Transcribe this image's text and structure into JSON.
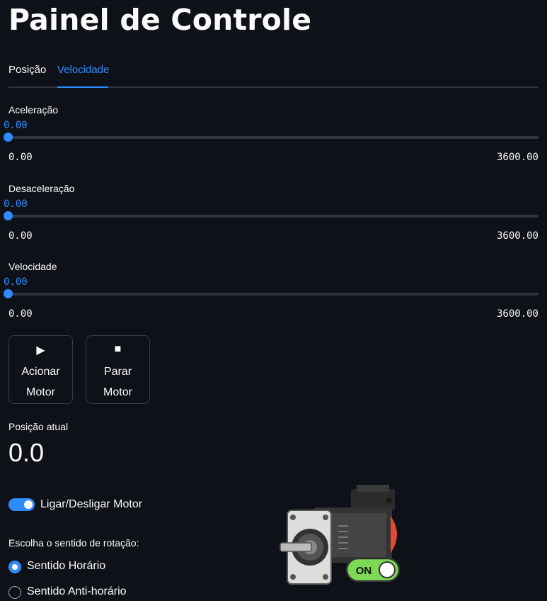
{
  "page": {
    "title": "Painel de Controle"
  },
  "tabs": [
    {
      "label": "Posição",
      "active": false
    },
    {
      "label": "Velocidade",
      "active": true
    }
  ],
  "sliders": [
    {
      "label": "Aceleração",
      "value": "0.00",
      "min": "0.00",
      "max": "3600.00"
    },
    {
      "label": "Desaceleração",
      "value": "0.00",
      "min": "0.00",
      "max": "3600.00"
    },
    {
      "label": "Velocidade",
      "value": "0.00",
      "min": "0.00",
      "max": "3600.00"
    }
  ],
  "buttons": {
    "start": {
      "icon": "▶",
      "label": "Acionar Motor"
    },
    "stop": {
      "icon": "■",
      "label": "Parar Motor"
    }
  },
  "metric": {
    "label": "Posição atual",
    "value": "0.0"
  },
  "toggle": {
    "label": "Ligar/Desligar Motor",
    "checked": true
  },
  "rotation": {
    "title": "Escolha o sentido de rotação:",
    "options": [
      {
        "label": "Sentido Horário",
        "checked": true
      },
      {
        "label": "Sentido Anti-horário",
        "checked": false
      }
    ]
  },
  "motor_badge": {
    "text": "ON"
  },
  "colors": {
    "accent": "#2f8cff",
    "background": "#0e1117",
    "text": "#fafafa",
    "badge": "#7ed957"
  }
}
